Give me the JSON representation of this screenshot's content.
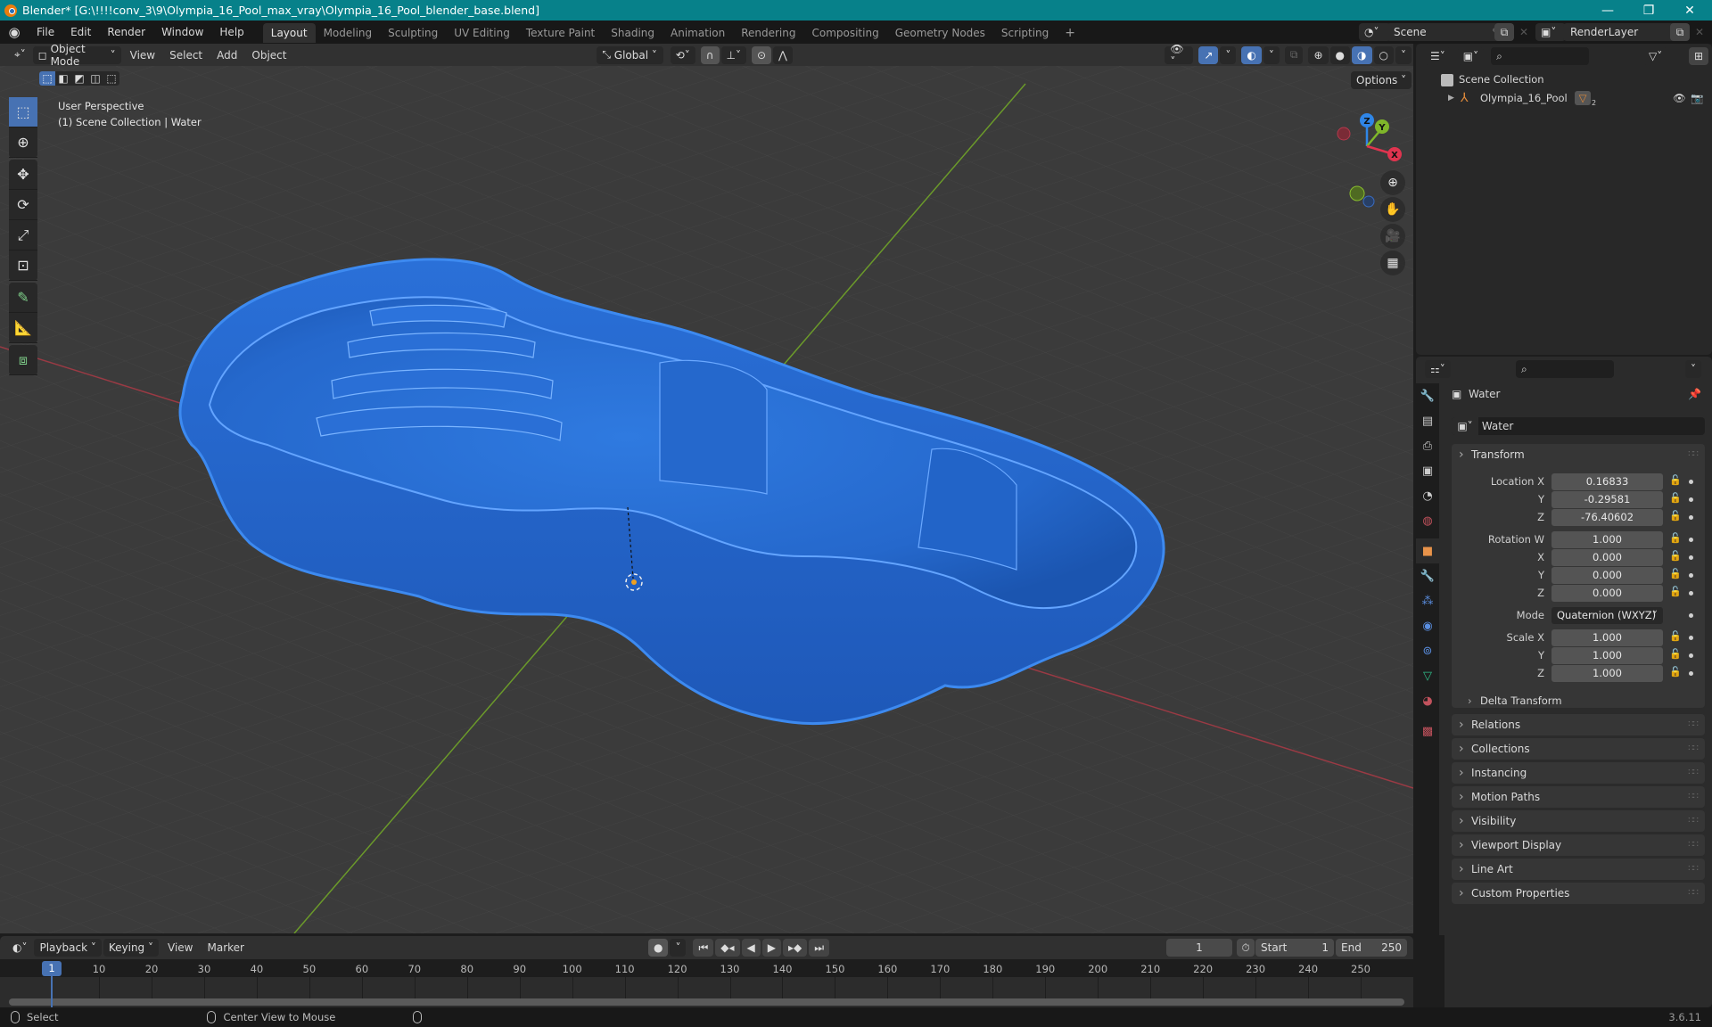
{
  "window": {
    "title": "Blender* [G:\\!!!!conv_3\\9\\Olympia_16_Pool_max_vray\\Olympia_16_Pool_blender_base.blend]",
    "controls": [
      "minimize",
      "maximize",
      "close"
    ]
  },
  "menubar": {
    "items": [
      "File",
      "Edit",
      "Render",
      "Window",
      "Help"
    ],
    "workspaces": [
      "Layout",
      "Modeling",
      "Sculpting",
      "UV Editing",
      "Texture Paint",
      "Shading",
      "Animation",
      "Rendering",
      "Compositing",
      "Geometry Nodes",
      "Scripting"
    ],
    "active_workspace": "Layout",
    "add_workspace": "+",
    "scene": "Scene",
    "view_layer": "RenderLayer"
  },
  "viewport": {
    "header": {
      "mode": "Object Mode",
      "menus": [
        "View",
        "Select",
        "Add",
        "Object"
      ],
      "transform_orientation": "Global",
      "options_label": "Options"
    },
    "overlay_text": {
      "perspective": "User Perspective",
      "collection": "(1) Scene Collection | Water"
    },
    "gizmo_axes": [
      "X",
      "Y",
      "Z"
    ],
    "tools": [
      "select-box",
      "cursor",
      "move",
      "rotate",
      "scale",
      "transform",
      "annotate",
      "measure",
      "add-cube"
    ],
    "object_color": "#2a6fd6"
  },
  "outliner": {
    "root": "Scene Collection",
    "items": [
      {
        "name": "Olympia_16_Pool",
        "badge_count": "2"
      }
    ]
  },
  "properties": {
    "object_name": "Water",
    "datablock_name": "Water",
    "transform": {
      "title": "Transform",
      "location": {
        "label": "Location X",
        "x": "0.16833",
        "y": "-0.29581",
        "z": "-76.40602"
      },
      "rotation": {
        "label": "Rotation W",
        "w": "1.000",
        "x": "0.000",
        "y": "0.000",
        "z": "0.000"
      },
      "mode_label": "Mode",
      "mode": "Quaternion (WXYZ)",
      "scale": {
        "label": "Scale X",
        "x": "1.000",
        "y": "1.000",
        "z": "1.000"
      },
      "axis_labels": {
        "x": "X",
        "y": "Y",
        "z": "Z"
      },
      "delta": "Delta Transform"
    },
    "panels": [
      "Relations",
      "Collections",
      "Instancing",
      "Motion Paths",
      "Visibility",
      "Viewport Display",
      "Line Art",
      "Custom Properties"
    ]
  },
  "timeline": {
    "menus": [
      "Playback",
      "Keying",
      "View",
      "Marker"
    ],
    "current_frame": "1",
    "start_label": "Start",
    "start": "1",
    "end_label": "End",
    "end": "250",
    "ticks": [
      "10",
      "20",
      "30",
      "40",
      "50",
      "60",
      "70",
      "80",
      "90",
      "100",
      "110",
      "120",
      "130",
      "140",
      "150",
      "160",
      "170",
      "180",
      "190",
      "200",
      "210",
      "220",
      "230",
      "240",
      "250"
    ],
    "playhead": "1"
  },
  "statusbar": {
    "left": "Select",
    "middle": "Center View to Mouse",
    "version": "3.6.11"
  }
}
